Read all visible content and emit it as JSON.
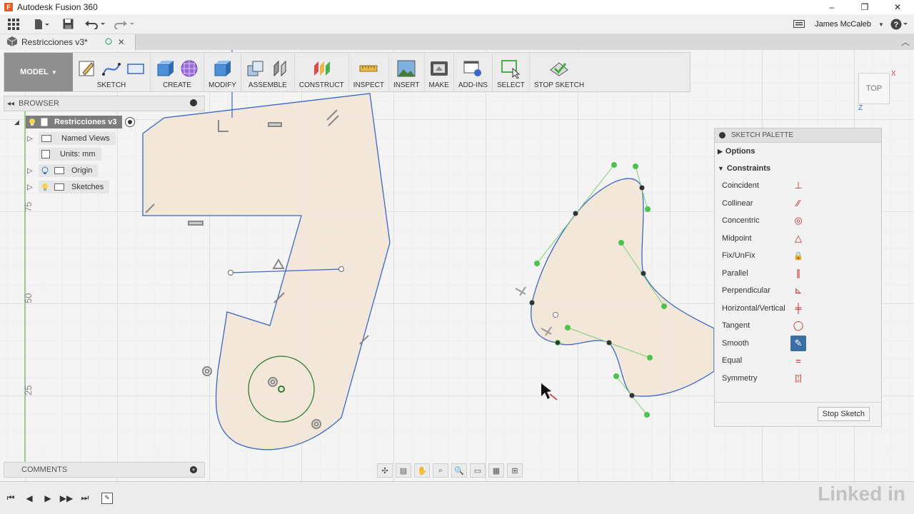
{
  "app": {
    "title": "Autodesk Fusion 360",
    "icon_letter": "F"
  },
  "window_controls": {
    "minimize": "–",
    "restore": "❐",
    "close": "✕"
  },
  "user": {
    "name": "James McCaleb"
  },
  "document": {
    "tab_title": "Restricciones v3*"
  },
  "toolbar": {
    "workspace": "MODEL",
    "groups": [
      {
        "label": "SKETCH"
      },
      {
        "label": "CREATE"
      },
      {
        "label": "MODIFY"
      },
      {
        "label": "ASSEMBLE"
      },
      {
        "label": "CONSTRUCT"
      },
      {
        "label": "INSPECT"
      },
      {
        "label": "INSERT"
      },
      {
        "label": "MAKE"
      },
      {
        "label": "ADD-INS"
      },
      {
        "label": "SELECT"
      },
      {
        "label": "STOP SKETCH"
      }
    ]
  },
  "browser": {
    "title": "BROWSER",
    "root": "Restricciones v3",
    "items": [
      {
        "label": "Named Views"
      },
      {
        "label": "Units: mm"
      },
      {
        "label": "Origin"
      },
      {
        "label": "Sketches"
      }
    ]
  },
  "comments": {
    "title": "COMMENTS"
  },
  "viewcube": {
    "face": "TOP",
    "axis_x": "X",
    "axis_z": "Z"
  },
  "ruler": {
    "ticks": [
      "75",
      "50",
      "25"
    ]
  },
  "palette": {
    "title": "SKETCH PALETTE",
    "options_label": "Options",
    "constraints_label": "Constraints",
    "constraints": [
      {
        "name": "Coincident",
        "icon": "⊥"
      },
      {
        "name": "Collinear",
        "icon": "⁄⁄"
      },
      {
        "name": "Concentric",
        "icon": "◎"
      },
      {
        "name": "Midpoint",
        "icon": "△"
      },
      {
        "name": "Fix/UnFix",
        "icon": "🔒"
      },
      {
        "name": "Parallel",
        "icon": "∥"
      },
      {
        "name": "Perpendicular",
        "icon": "⊾"
      },
      {
        "name": "Horizontal/Vertical",
        "icon": "╪"
      },
      {
        "name": "Tangent",
        "icon": "◯"
      },
      {
        "name": "Smooth",
        "icon": "✎"
      },
      {
        "name": "Equal",
        "icon": "="
      },
      {
        "name": "Symmetry",
        "icon": "[¦]"
      }
    ],
    "stop_button": "Stop Sketch"
  },
  "watermark": "Linked in"
}
